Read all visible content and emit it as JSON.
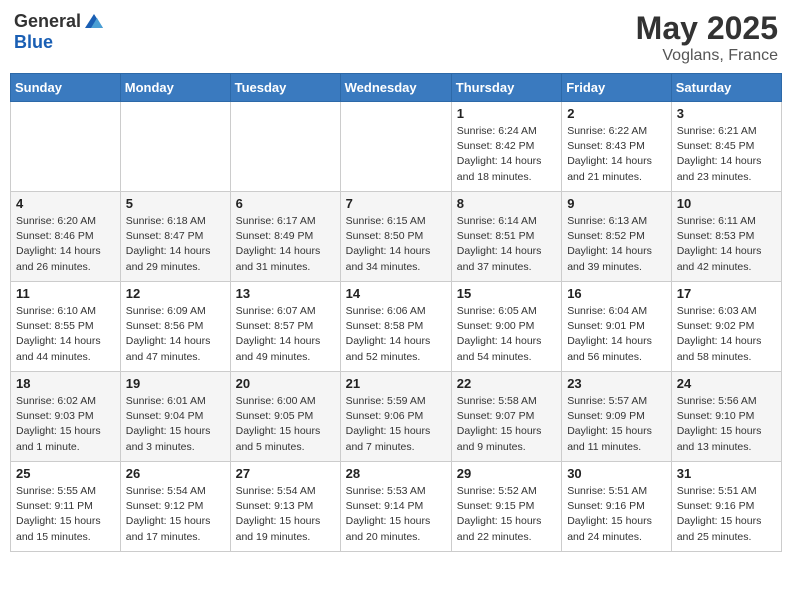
{
  "header": {
    "logo_general": "General",
    "logo_blue": "Blue",
    "title": "May 2025",
    "subtitle": "Voglans, France"
  },
  "days_of_week": [
    "Sunday",
    "Monday",
    "Tuesday",
    "Wednesday",
    "Thursday",
    "Friday",
    "Saturday"
  ],
  "weeks": [
    [
      {
        "day": "",
        "info": ""
      },
      {
        "day": "",
        "info": ""
      },
      {
        "day": "",
        "info": ""
      },
      {
        "day": "",
        "info": ""
      },
      {
        "day": "1",
        "info": "Sunrise: 6:24 AM\nSunset: 8:42 PM\nDaylight: 14 hours\nand 18 minutes."
      },
      {
        "day": "2",
        "info": "Sunrise: 6:22 AM\nSunset: 8:43 PM\nDaylight: 14 hours\nand 21 minutes."
      },
      {
        "day": "3",
        "info": "Sunrise: 6:21 AM\nSunset: 8:45 PM\nDaylight: 14 hours\nand 23 minutes."
      }
    ],
    [
      {
        "day": "4",
        "info": "Sunrise: 6:20 AM\nSunset: 8:46 PM\nDaylight: 14 hours\nand 26 minutes."
      },
      {
        "day": "5",
        "info": "Sunrise: 6:18 AM\nSunset: 8:47 PM\nDaylight: 14 hours\nand 29 minutes."
      },
      {
        "day": "6",
        "info": "Sunrise: 6:17 AM\nSunset: 8:49 PM\nDaylight: 14 hours\nand 31 minutes."
      },
      {
        "day": "7",
        "info": "Sunrise: 6:15 AM\nSunset: 8:50 PM\nDaylight: 14 hours\nand 34 minutes."
      },
      {
        "day": "8",
        "info": "Sunrise: 6:14 AM\nSunset: 8:51 PM\nDaylight: 14 hours\nand 37 minutes."
      },
      {
        "day": "9",
        "info": "Sunrise: 6:13 AM\nSunset: 8:52 PM\nDaylight: 14 hours\nand 39 minutes."
      },
      {
        "day": "10",
        "info": "Sunrise: 6:11 AM\nSunset: 8:53 PM\nDaylight: 14 hours\nand 42 minutes."
      }
    ],
    [
      {
        "day": "11",
        "info": "Sunrise: 6:10 AM\nSunset: 8:55 PM\nDaylight: 14 hours\nand 44 minutes."
      },
      {
        "day": "12",
        "info": "Sunrise: 6:09 AM\nSunset: 8:56 PM\nDaylight: 14 hours\nand 47 minutes."
      },
      {
        "day": "13",
        "info": "Sunrise: 6:07 AM\nSunset: 8:57 PM\nDaylight: 14 hours\nand 49 minutes."
      },
      {
        "day": "14",
        "info": "Sunrise: 6:06 AM\nSunset: 8:58 PM\nDaylight: 14 hours\nand 52 minutes."
      },
      {
        "day": "15",
        "info": "Sunrise: 6:05 AM\nSunset: 9:00 PM\nDaylight: 14 hours\nand 54 minutes."
      },
      {
        "day": "16",
        "info": "Sunrise: 6:04 AM\nSunset: 9:01 PM\nDaylight: 14 hours\nand 56 minutes."
      },
      {
        "day": "17",
        "info": "Sunrise: 6:03 AM\nSunset: 9:02 PM\nDaylight: 14 hours\nand 58 minutes."
      }
    ],
    [
      {
        "day": "18",
        "info": "Sunrise: 6:02 AM\nSunset: 9:03 PM\nDaylight: 15 hours\nand 1 minute."
      },
      {
        "day": "19",
        "info": "Sunrise: 6:01 AM\nSunset: 9:04 PM\nDaylight: 15 hours\nand 3 minutes."
      },
      {
        "day": "20",
        "info": "Sunrise: 6:00 AM\nSunset: 9:05 PM\nDaylight: 15 hours\nand 5 minutes."
      },
      {
        "day": "21",
        "info": "Sunrise: 5:59 AM\nSunset: 9:06 PM\nDaylight: 15 hours\nand 7 minutes."
      },
      {
        "day": "22",
        "info": "Sunrise: 5:58 AM\nSunset: 9:07 PM\nDaylight: 15 hours\nand 9 minutes."
      },
      {
        "day": "23",
        "info": "Sunrise: 5:57 AM\nSunset: 9:09 PM\nDaylight: 15 hours\nand 11 minutes."
      },
      {
        "day": "24",
        "info": "Sunrise: 5:56 AM\nSunset: 9:10 PM\nDaylight: 15 hours\nand 13 minutes."
      }
    ],
    [
      {
        "day": "25",
        "info": "Sunrise: 5:55 AM\nSunset: 9:11 PM\nDaylight: 15 hours\nand 15 minutes."
      },
      {
        "day": "26",
        "info": "Sunrise: 5:54 AM\nSunset: 9:12 PM\nDaylight: 15 hours\nand 17 minutes."
      },
      {
        "day": "27",
        "info": "Sunrise: 5:54 AM\nSunset: 9:13 PM\nDaylight: 15 hours\nand 19 minutes."
      },
      {
        "day": "28",
        "info": "Sunrise: 5:53 AM\nSunset: 9:14 PM\nDaylight: 15 hours\nand 20 minutes."
      },
      {
        "day": "29",
        "info": "Sunrise: 5:52 AM\nSunset: 9:15 PM\nDaylight: 15 hours\nand 22 minutes."
      },
      {
        "day": "30",
        "info": "Sunrise: 5:51 AM\nSunset: 9:16 PM\nDaylight: 15 hours\nand 24 minutes."
      },
      {
        "day": "31",
        "info": "Sunrise: 5:51 AM\nSunset: 9:16 PM\nDaylight: 15 hours\nand 25 minutes."
      }
    ]
  ]
}
